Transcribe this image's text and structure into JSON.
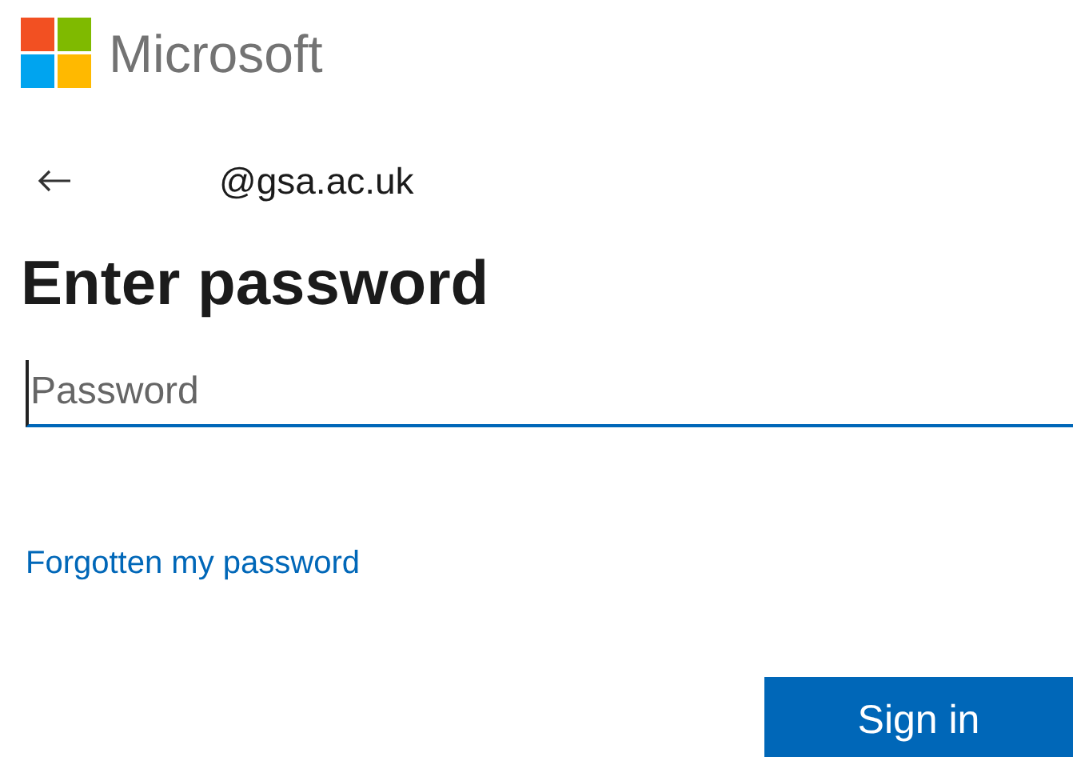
{
  "brand": {
    "name": "Microsoft"
  },
  "identity": {
    "email": "@gsa.ac.uk"
  },
  "title": "Enter password",
  "password_field": {
    "placeholder": "Password",
    "focused": true
  },
  "link": "Forgotten my password",
  "buttons": [
    "Sign in"
  ]
}
